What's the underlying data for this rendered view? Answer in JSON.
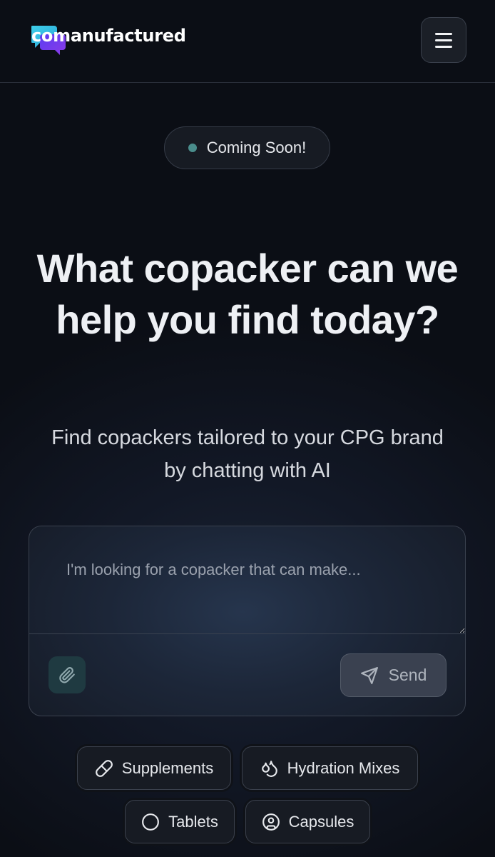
{
  "header": {
    "logo_text": "comanufactured",
    "logo_icon": "chat-bubbles-logo",
    "menu_icon": "hamburger-menu-icon"
  },
  "badge": {
    "label": "Coming Soon!",
    "dot_color": "#4a8d8c"
  },
  "hero": {
    "headline_line1": "What copacker can we",
    "headline_line2": "help you find today?",
    "subline_line1": "Find copackers tailored to your CPG brand",
    "subline_line2": "by chatting with AI"
  },
  "chat": {
    "placeholder": "I'm looking for a copacker that can make...",
    "value": "",
    "attach_icon": "paperclip-icon",
    "send_icon": "paper-plane-icon",
    "send_label": "Send"
  },
  "suggestions": [
    {
      "label": "Supplements",
      "icon": "pill-icon"
    },
    {
      "label": "Hydration Mixes",
      "icon": "droplets-icon"
    },
    {
      "label": "Tablets",
      "icon": "circle-icon"
    },
    {
      "label": "Capsules",
      "icon": "user-circle-icon"
    }
  ],
  "colors": {
    "background": "#0b0e15",
    "accent_teal": "#4a8d8c",
    "logo_cyan": "#36c3e8",
    "logo_purple": "#6a3df0"
  }
}
